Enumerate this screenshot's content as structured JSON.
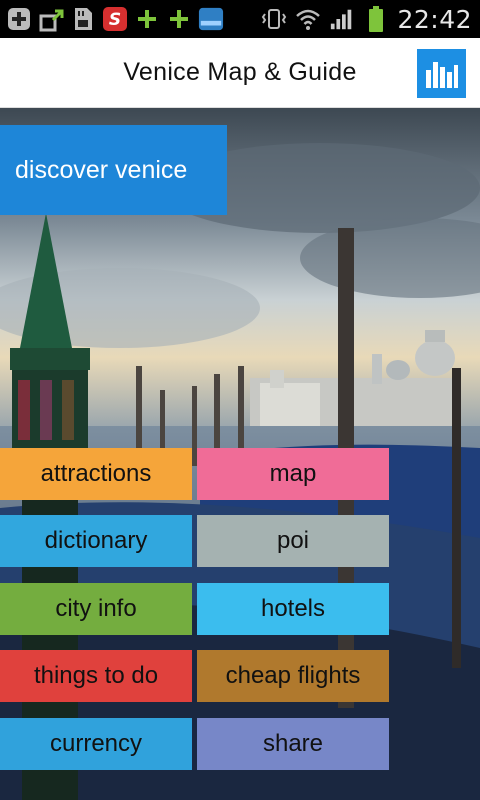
{
  "status_bar": {
    "time": "22:42",
    "icons": [
      "add-icon",
      "upload-icon",
      "sd-card-icon",
      "s-app-icon",
      "plus-icon",
      "plus-icon",
      "weather-app-icon",
      "vibrate-icon",
      "wifi-icon",
      "signal-icon",
      "battery-icon"
    ]
  },
  "action_bar": {
    "title": "Venice Map & Guide",
    "menu_icon": "bar-chart-icon"
  },
  "discover": {
    "label": "discover venice",
    "color": "#1e86d8"
  },
  "menu": [
    {
      "label": "attractions",
      "color": "#f5a53a"
    },
    {
      "label": "map",
      "color": "#f06c97"
    },
    {
      "label": "dictionary",
      "color": "#31a7de"
    },
    {
      "label": "poi",
      "color": "#a5b2b1"
    },
    {
      "label": "city info",
      "color": "#74ad3f"
    },
    {
      "label": "hotels",
      "color": "#3bbdee"
    },
    {
      "label": "things to do",
      "color": "#e0413d"
    },
    {
      "label": "cheap flights",
      "color": "#b0792d"
    },
    {
      "label": "currency",
      "color": "#30a2dc"
    },
    {
      "label": "share",
      "color": "#7787c8"
    }
  ]
}
